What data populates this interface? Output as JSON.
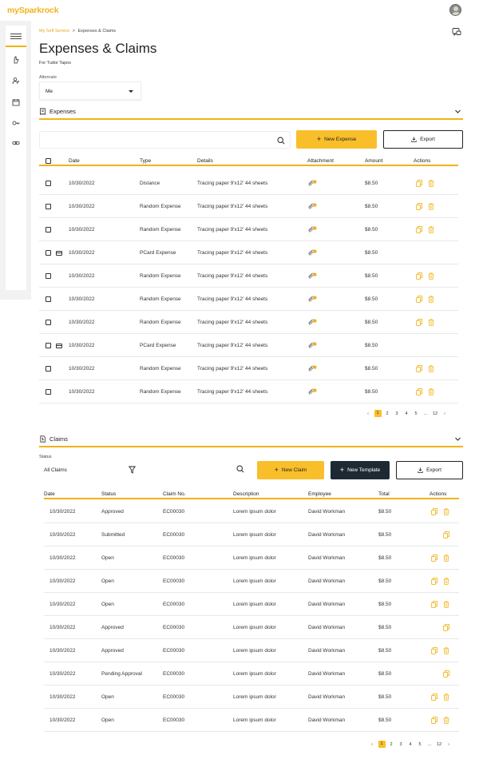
{
  "app": {
    "logo": "mySparkrock"
  },
  "breadcrumb": {
    "parent": "My Self Service",
    "separator": ">",
    "current": "Expenses & Claims"
  },
  "page": {
    "title": "Expenses & Claims",
    "subtitle": "For Tudor Tapos"
  },
  "alternate": {
    "label": "Alternate",
    "value": "Me"
  },
  "sidebar": {
    "icons": [
      "menu-icon",
      "hand-icon",
      "people-icon",
      "calendar-icon",
      "key-icon",
      "link-icon"
    ]
  },
  "expenses": {
    "title": "Expenses",
    "search_placeholder": "",
    "new_button": "New Expense",
    "export_button": "Export",
    "columns": [
      "Date",
      "Type",
      "Details",
      "Attachment",
      "Amount",
      "Actions"
    ],
    "rows": [
      {
        "date": "10/30/2022",
        "type": "Distance",
        "details": "Tracing paper 9'x12' 44 sheets",
        "amount": "$8.50",
        "pcard": false
      },
      {
        "date": "10/30/2022",
        "type": "Random Expense",
        "details": "Tracing paper 9'x12' 44 sheets",
        "amount": "$8.50",
        "pcard": false
      },
      {
        "date": "10/30/2022",
        "type": "Random Expense",
        "details": "Tracing paper 9'x12' 44 sheets",
        "amount": "$8.50",
        "pcard": false
      },
      {
        "date": "10/30/2022",
        "type": "PCard Expense",
        "details": "Tracing paper 9'x12' 44 sheets",
        "amount": "$8.50",
        "pcard": true
      },
      {
        "date": "10/30/2022",
        "type": "Random Expense",
        "details": "Tracing paper 9'x12' 44 sheets",
        "amount": "$8.50",
        "pcard": false
      },
      {
        "date": "10/30/2022",
        "type": "Random Expense",
        "details": "Tracing paper 9'x12' 44 sheets",
        "amount": "$8.50",
        "pcard": false
      },
      {
        "date": "10/30/2022",
        "type": "Random Expense",
        "details": "Tracing paper 9'x12' 44 sheets",
        "amount": "$8.50",
        "pcard": false
      },
      {
        "date": "10/30/2022",
        "type": "PCard Expense",
        "details": "Tracing paper 9'x12' 44 sheets",
        "amount": "$8.50",
        "pcard": true
      },
      {
        "date": "10/30/2022",
        "type": "Random Expense",
        "details": "Tracing paper 9'x12' 44 sheets",
        "amount": "$8.50",
        "pcard": false
      },
      {
        "date": "10/30/2022",
        "type": "Random Expense",
        "details": "Tracing paper 9'x12' 44 sheets",
        "amount": "$8.50",
        "pcard": false
      }
    ],
    "pagination": {
      "prev": "‹",
      "pages": [
        "1",
        "2",
        "3",
        "4",
        "5",
        "…",
        "12"
      ],
      "current": "1",
      "next": "›"
    }
  },
  "claims": {
    "title": "Claims",
    "status_label": "Status",
    "status_value": "All Claims",
    "new_button": "New Claim",
    "template_button": "New Template",
    "export_button": "Export",
    "columns": [
      "Date",
      "Status",
      "Claim No.",
      "Description",
      "Employee",
      "Total",
      "Actions"
    ],
    "rows": [
      {
        "date": "10/30/2022",
        "status": "Approved",
        "claim": "EC00030",
        "description": "Lorem ipsum dolor",
        "employee": "David Workman",
        "total": "$8.50",
        "delete": true
      },
      {
        "date": "10/30/2022",
        "status": "Submitted",
        "claim": "EC00030",
        "description": "Lorem ipsum dolor",
        "employee": "David Workman",
        "total": "$8.50",
        "delete": false
      },
      {
        "date": "10/30/2022",
        "status": "Open",
        "claim": "EC00030",
        "description": "Lorem ipsum dolor",
        "employee": "David Workman",
        "total": "$8.50",
        "delete": true
      },
      {
        "date": "10/30/2022",
        "status": "Open",
        "claim": "EC00030",
        "description": "Lorem ipsum dolor",
        "employee": "David Workman",
        "total": "$8.50",
        "delete": true
      },
      {
        "date": "10/30/2022",
        "status": "Open",
        "claim": "EC00030",
        "description": "Lorem ipsum dolor",
        "employee": "David Workman",
        "total": "$8.50",
        "delete": true
      },
      {
        "date": "10/30/2022",
        "status": "Approved",
        "claim": "EC00030",
        "description": "Lorem ipsum dolor",
        "employee": "David Workman",
        "total": "$8.50",
        "delete": false
      },
      {
        "date": "10/30/2022",
        "status": "Approved",
        "claim": "EC00030",
        "description": "Lorem ipsum dolor",
        "employee": "David Workman",
        "total": "$8.50",
        "delete": true
      },
      {
        "date": "10/30/2022",
        "status": "Pending Approval",
        "claim": "EC00030",
        "description": "Lorem ipsum dolor",
        "employee": "David Workman",
        "total": "$8.50",
        "delete": false
      },
      {
        "date": "10/30/2022",
        "status": "Open",
        "claim": "EC00030",
        "description": "Lorem ipsum dolor",
        "employee": "David Workman",
        "total": "$8.50",
        "delete": true
      },
      {
        "date": "10/30/2022",
        "status": "Open",
        "claim": "EC00030",
        "description": "Lorem ipsum dolor",
        "employee": "David Workman",
        "total": "$8.50",
        "delete": true
      }
    ],
    "pagination": {
      "prev": "‹",
      "pages": [
        "1",
        "2",
        "3",
        "4",
        "5",
        "…",
        "12"
      ],
      "current": "1",
      "next": "›"
    }
  },
  "colors": {
    "accent": "#f9bf2b",
    "dark_button": "#1e2a33",
    "background": "#f2f2f2"
  }
}
